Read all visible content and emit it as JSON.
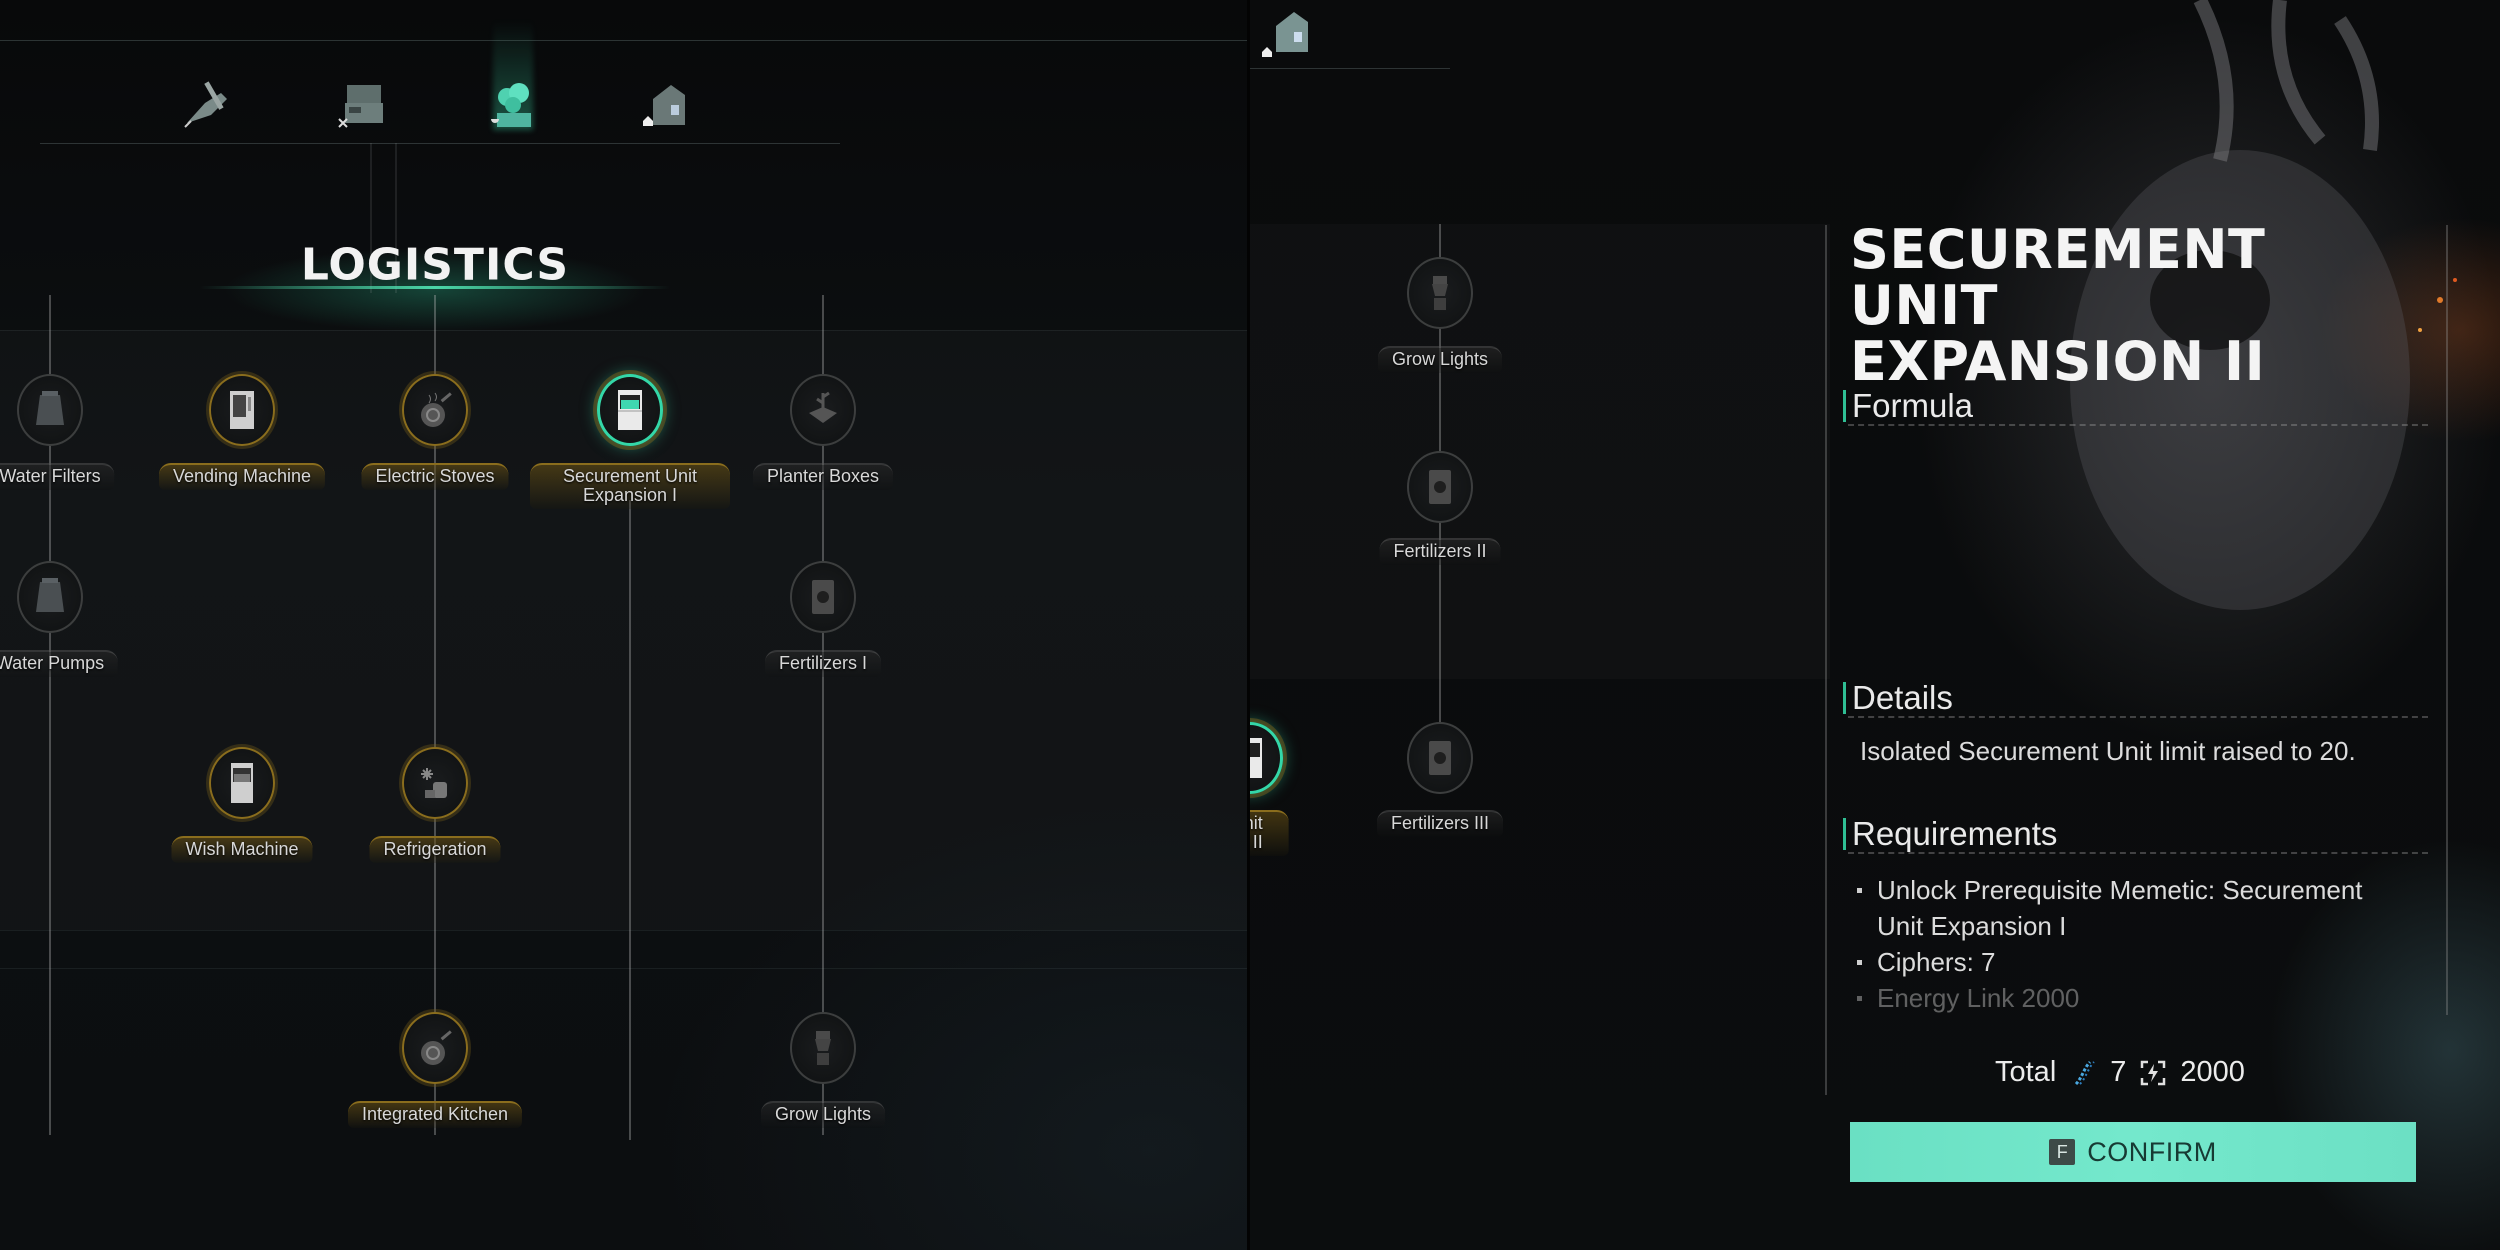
{
  "left_screen": {
    "category_tabs": [
      {
        "name": "combat",
        "icon": "chainsaw-icon",
        "sub_icon": "wrench-icon",
        "active": false
      },
      {
        "name": "crafting",
        "icon": "workbench-icon",
        "sub_icon": "tools-icon",
        "active": false
      },
      {
        "name": "logistics",
        "icon": "plant-tree-icon",
        "sub_icon": "leaf-icon",
        "active": true
      },
      {
        "name": "base",
        "icon": "house-icon",
        "sub_icon": "home-icon",
        "active": false
      }
    ],
    "section_title": "LOGISTICS",
    "nodes": [
      {
        "label": "Water Filters",
        "icon": "water-filter-icon",
        "state": "locked"
      },
      {
        "label": "Vending Machine",
        "icon": "vending-machine-icon",
        "state": "unlocked"
      },
      {
        "label": "Electric Stoves",
        "icon": "stove-pan-icon",
        "state": "unlocked"
      },
      {
        "label": "Securement Unit Expansion I",
        "icon": "securement-unit-icon",
        "state": "selected"
      },
      {
        "label": "Planter Boxes",
        "icon": "planter-box-icon",
        "state": "locked"
      },
      {
        "label": "Water Pumps",
        "icon": "water-pump-icon",
        "state": "locked"
      },
      {
        "label": "Fertilizers I",
        "icon": "fertilizer-bag-icon",
        "state": "locked"
      },
      {
        "label": "Wish Machine",
        "icon": "wish-machine-icon",
        "state": "unlocked"
      },
      {
        "label": "Refrigeration",
        "icon": "refrigeration-icon",
        "state": "unlocked"
      },
      {
        "label": "Integrated Kitchen",
        "icon": "kitchen-pan-icon",
        "state": "unlocked"
      },
      {
        "label": "Grow Lights",
        "icon": "grow-light-icon",
        "state": "locked"
      }
    ]
  },
  "right_screen": {
    "category_tab": {
      "name": "base",
      "icon": "house-icon"
    },
    "nodes": [
      {
        "label": "Grow Lights",
        "icon": "grow-light-icon",
        "state": "locked"
      },
      {
        "label": "Fertilizers II",
        "icon": "fertilizer-bag-icon",
        "state": "locked"
      },
      {
        "label": "Fertilizers III",
        "icon": "fertilizer-bag-icon",
        "state": "locked"
      },
      {
        "label": "ent Unit\nsion II",
        "icon": "securement-unit-icon",
        "state": "selected"
      }
    ],
    "detail": {
      "title_line1": "SECUREMENT UNIT",
      "title_line2": "EXPANSION II",
      "formula_heading": "Formula",
      "details_heading": "Details",
      "details_text": "Isolated Securement Unit limit raised to 20.",
      "requirements_heading": "Requirements",
      "requirements": [
        "Unlock Prerequisite Memetic: Securement Unit Expansion I",
        "Ciphers:  7",
        "Energy Link 2000"
      ],
      "total_label": "Total",
      "total_ciphers": "7",
      "total_energy": "2000",
      "confirm_key": "F",
      "confirm_label": "CONFIRM"
    },
    "colors": {
      "accent": "#34d7a8",
      "confirm_bg": "#6ee2c6",
      "gold": "#8a6d1d"
    }
  }
}
